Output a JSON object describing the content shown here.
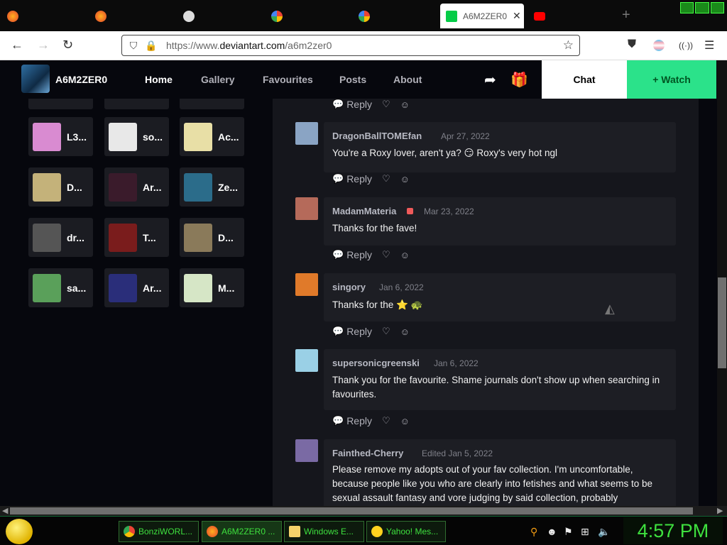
{
  "browser": {
    "active_tab_title": "A6M2ZER0 |",
    "tab_close": "✕",
    "new_tab": "+",
    "url_prefix": "https://www.",
    "url_domain": "deviantart.com",
    "url_path": "/a6m2zer0"
  },
  "header": {
    "username": "A6M2ZER0",
    "nav": [
      "Home",
      "Gallery",
      "Favourites",
      "Posts",
      "About"
    ],
    "chat_label": "Chat",
    "watch_label": "+ Watch"
  },
  "watchers": [
    {
      "name": "L3...",
      "color": "#d98bd1"
    },
    {
      "name": "so...",
      "color": "#e8e8e8"
    },
    {
      "name": "Ac...",
      "color": "#e8dfa6"
    },
    {
      "name": "D...",
      "color": "#c4b27a"
    },
    {
      "name": "Ar...",
      "color": "#3a1b2b"
    },
    {
      "name": "Ze...",
      "color": "#2b6c8a"
    },
    {
      "name": "dr...",
      "color": "#555"
    },
    {
      "name": "T...",
      "color": "#7a1c1c"
    },
    {
      "name": "D...",
      "color": "#8a7a5a"
    },
    {
      "name": "sa...",
      "color": "#5aa05a"
    },
    {
      "name": "Ar...",
      "color": "#2a2e7a"
    },
    {
      "name": "M...",
      "color": "#d6e6c6"
    }
  ],
  "comments": [
    {
      "user": "DragonBallTOMEfan",
      "date": "Apr 27, 2022",
      "text": "You're a Roxy lover, aren't ya? 😏 Roxy's very hot ngl",
      "color": "#8aa4c4"
    },
    {
      "user": "MadamMateria",
      "date": "Mar 23, 2022",
      "text": "Thanks for the fave!",
      "color": "#b56a5a"
    },
    {
      "user": "singory",
      "date": "Jan 6, 2022",
      "text": "Thanks for the ⭐ 🐢",
      "color": "#e07a2a"
    },
    {
      "user": "supersonicgreenski",
      "date": "Jan 6, 2022",
      "text": "Thank you for the favourite. Shame journals don't show up when searching in favourites.",
      "color": "#9ad0e6"
    },
    {
      "user": "Fainthed-Cherry",
      "date": "Edited Jan 5, 2022",
      "text": "Please remove my adopts out of your fav collection. I'm uncomfortable, because people like you who are clearly into fetishes and what seems to be sexual assault fantasy and vore judging by said collection, probably",
      "color": "#7a6aa4"
    }
  ],
  "reply_label": "Reply",
  "taskbar": {
    "buttons": [
      "BonziWORL...",
      "A6M2ZER0 ...",
      "Windows E...",
      "Yahoo! Mes..."
    ],
    "clock": "4:57 PM"
  }
}
